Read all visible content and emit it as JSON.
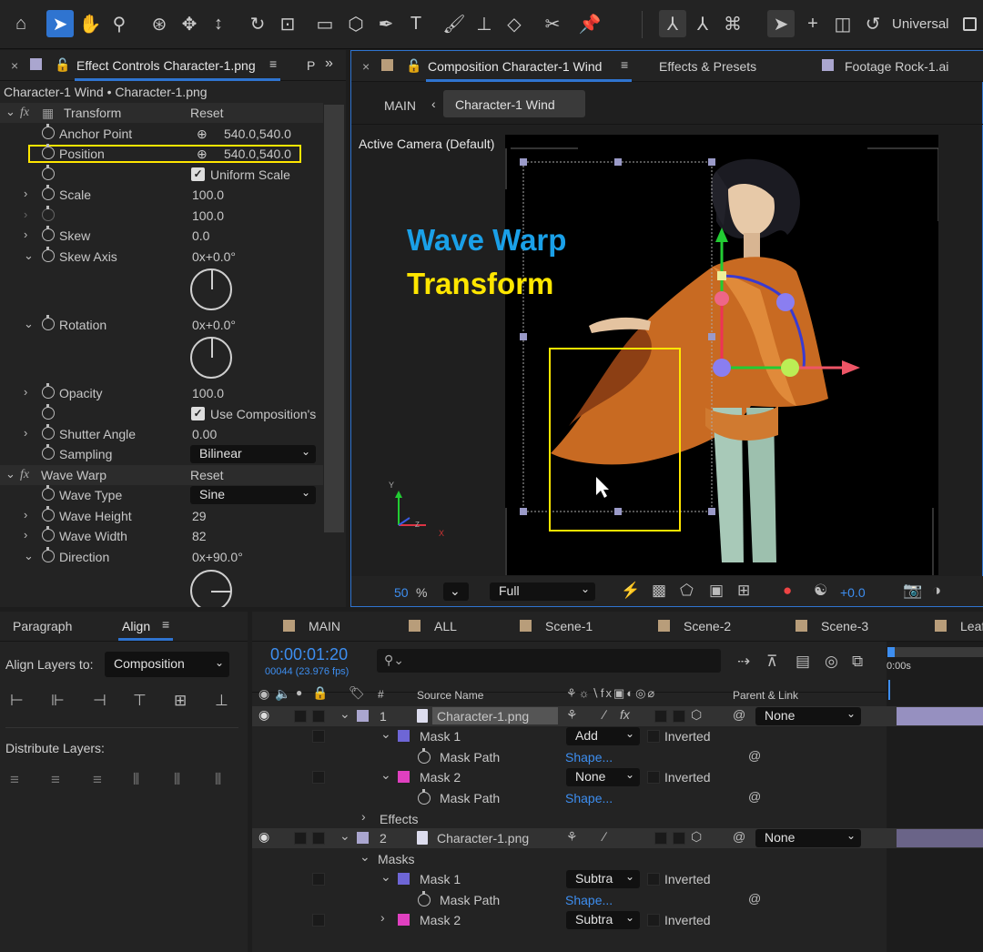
{
  "toolbar": {
    "workspace_label": "Universal"
  },
  "effect_controls": {
    "tab_label": "Effect Controls Character-1.png",
    "tab2_label": "P",
    "subtitle": "Character-1 Wind • Character-1.png",
    "transform": {
      "title": "Transform",
      "reset": "Reset",
      "anchor_label": "Anchor Point",
      "anchor_value": "540.0,540.0",
      "position_label": "Position",
      "position_value": "540.0,540.0",
      "uniform_scale": "Uniform Scale",
      "scale_label": "Scale",
      "scale_value": "100.0",
      "scale2_value": "100.0",
      "skew_label": "Skew",
      "skew_value": "0.0",
      "skew_axis_label": "Skew Axis",
      "skew_axis_value": "0x+0.0°",
      "rotation_label": "Rotation",
      "rotation_value": "0x+0.0°",
      "opacity_label": "Opacity",
      "opacity_value": "100.0",
      "use_comp": "Use Composition's",
      "shutter_label": "Shutter Angle",
      "shutter_value": "0.00",
      "sampling_label": "Sampling",
      "sampling_value": "Bilinear"
    },
    "wave_warp": {
      "title": "Wave Warp",
      "reset": "Reset",
      "type_label": "Wave Type",
      "type_value": "Sine",
      "height_label": "Wave Height",
      "height_value": "29",
      "width_label": "Wave Width",
      "width_value": "82",
      "direction_label": "Direction",
      "direction_value": "0x+90.0°"
    }
  },
  "composition": {
    "tab_label": "Composition Character-1 Wind",
    "tab2_label": "Effects & Presets",
    "tab3_label": "Footage Rock-1.ai",
    "crumb_main": "MAIN",
    "crumb_current": "Character-1 Wind",
    "camera_label": "Active Camera (Default)",
    "overlay_title1": "Wave Warp",
    "overlay_title2": "Transform",
    "zoom_value": "50",
    "zoom_unit": "%",
    "resolution": "Full",
    "exposure": "+0.0"
  },
  "align": {
    "tab1": "Paragraph",
    "tab2": "Align",
    "align_to_label": "Align Layers to:",
    "align_to_value": "Composition",
    "distribute_label": "Distribute Layers:"
  },
  "timeline": {
    "tabs": [
      "MAIN",
      "ALL",
      "Scene-1",
      "Scene-2",
      "Scene-3",
      "Leaf"
    ],
    "timecode": "0:00:01:20",
    "frames": "00044 (23.976 fps)",
    "ruler_start": "0:00s",
    "col_hash": "#",
    "col_source": "Source Name",
    "col_parent": "Parent & Link",
    "layer1": {
      "num": "1",
      "name": "Character-1.png",
      "parent": "None"
    },
    "mask1": {
      "name": "Mask 1",
      "mode": "Add",
      "inverted": "Inverted",
      "path_label": "Mask Path",
      "path_value": "Shape..."
    },
    "mask2": {
      "name": "Mask 2",
      "mode": "None",
      "inverted": "Inverted",
      "path_label": "Mask Path",
      "path_value": "Shape..."
    },
    "effects_label": "Effects",
    "layer2": {
      "num": "2",
      "name": "Character-1.png",
      "parent": "None"
    },
    "masks_label": "Masks",
    "l2mask1": {
      "name": "Mask 1",
      "mode": "Subtra",
      "inverted": "Inverted",
      "path_label": "Mask Path",
      "path_value": "Shape..."
    },
    "l2mask2": {
      "name": "Mask 2",
      "mode": "Subtra",
      "inverted": "Inverted"
    }
  },
  "colors": {
    "accent": "#2f74d0",
    "value_blue": "#3d8ef0",
    "highlight_yellow": "#ffe600",
    "wave_blue": "#1aa0e8"
  }
}
